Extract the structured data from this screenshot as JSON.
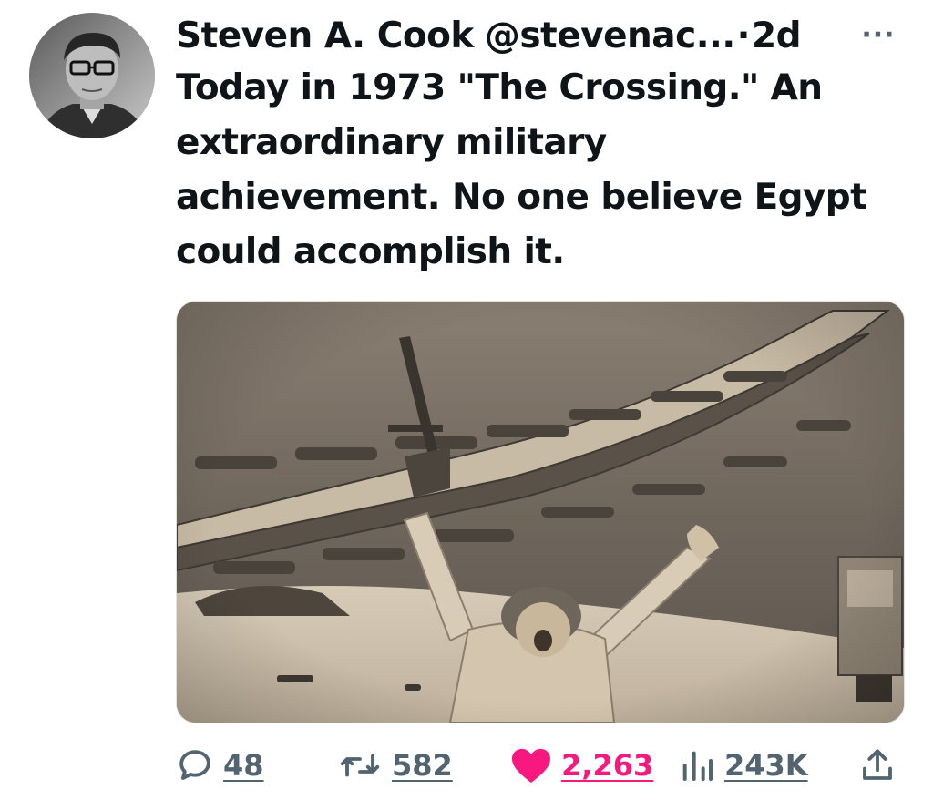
{
  "author": {
    "display_name": "Steven A. Cook",
    "handle": "@stevenac...",
    "separator": "·",
    "timestamp": "2d",
    "more_label": "···"
  },
  "tweet": {
    "text_lines": [
      "Today in 1973 \"The Crossing.\" An",
      "extraordinary military",
      "achievement. No one believe Egypt",
      "could accomplish it."
    ]
  },
  "actions": {
    "replies": "48",
    "retweets": "582",
    "likes": "2,263",
    "views": "243K"
  },
  "colors": {
    "text": "#0f1419",
    "secondary": "#536471",
    "like": "#f91880"
  },
  "icons": {
    "reply": "reply-icon",
    "retweet": "retweet-icon",
    "like": "heart-icon",
    "views": "views-icon",
    "share": "share-icon",
    "more": "more-icon"
  }
}
